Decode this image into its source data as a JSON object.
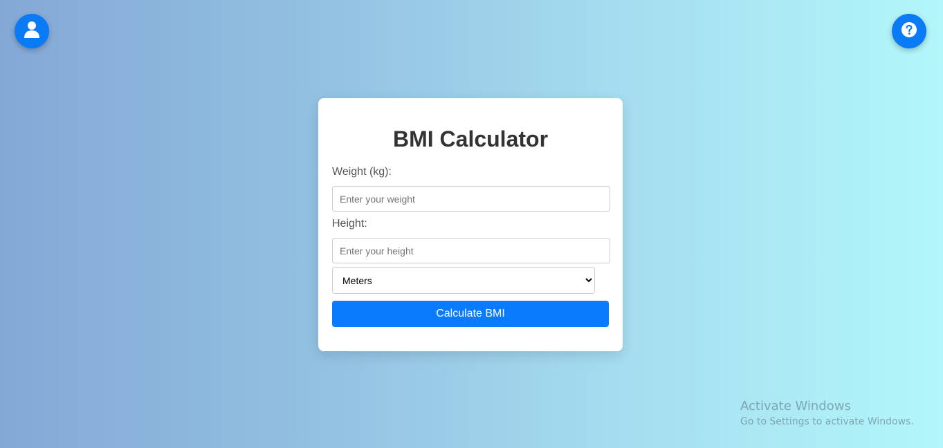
{
  "top_buttons": {
    "user_icon": "user-icon",
    "help_icon": "help-icon"
  },
  "colors": {
    "accent": "#0a7bfd",
    "background_start": "#84a8d6",
    "background_end": "#b2f7fa"
  },
  "card": {
    "title": "BMI Calculator",
    "weight": {
      "label": "Weight (kg):",
      "placeholder": "Enter your weight",
      "value": ""
    },
    "height": {
      "label": "Height:",
      "placeholder": "Enter your height",
      "value": ""
    },
    "unit_select": {
      "selected": "Meters"
    },
    "calculate_label": "Calculate BMI"
  },
  "watermark": {
    "title": "Activate Windows",
    "subtitle": "Go to Settings to activate Windows."
  }
}
